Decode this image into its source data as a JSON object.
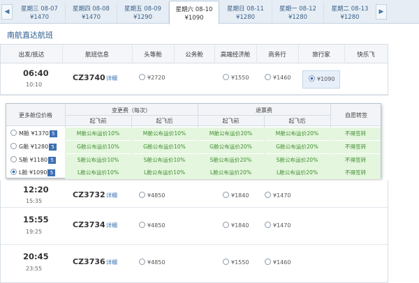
{
  "date_tabs": [
    {
      "date": "星期三  08-07",
      "price": "¥1470"
    },
    {
      "date": "星期四  08-08",
      "price": "¥1470"
    },
    {
      "date": "星期五  08-09",
      "price": "¥1290"
    },
    {
      "date": "星期六  08-10",
      "price": "¥1090"
    },
    {
      "date": "星期日  08-11",
      "price": "¥1280"
    },
    {
      "date": "星期一  08-12",
      "price": "¥1280"
    },
    {
      "date": "星期二  08-13",
      "price": "¥1280"
    }
  ],
  "active_tab_index": 3,
  "heading": "南航直达航班",
  "columns": [
    "出发/抵达",
    "航班信息",
    "头等舱",
    "公务舱",
    "高端经济舱",
    "商务行",
    "旅行家",
    "快乐飞"
  ],
  "detail_label": "详细",
  "flights": [
    {
      "dep": "06:40",
      "arr": "10:10",
      "no": "CZ3740",
      "first": "¥2720",
      "premium": "¥1550",
      "biz": "¥1460",
      "traveler": "¥1090"
    },
    {
      "dep": "12:20",
      "arr": "15:35",
      "no": "CZ3732",
      "first": "¥4850",
      "premium": "¥1840",
      "biz": "¥1470",
      "traveler": ""
    },
    {
      "dep": "15:55",
      "arr": "19:25",
      "no": "CZ3734",
      "first": "¥4850",
      "premium": "¥1840",
      "biz": "¥1470",
      "traveler": ""
    },
    {
      "dep": "20:45",
      "arr": "23:55",
      "no": "CZ3736",
      "first": "¥4850",
      "premium": "¥1550",
      "biz": "¥1460",
      "traveler": ""
    }
  ],
  "popup": {
    "more_label": "更多舱位价格",
    "change_fee": "变更费（每次）",
    "refund_fee": "退票费",
    "endorse": "自愿转签",
    "before": "起飞前",
    "after": "起飞后",
    "badge": "5",
    "classes": [
      {
        "label": "M舱 ¥1370",
        "change_before": "M舱公布运价10%",
        "change_after": "M舱公布运价10%",
        "refund_before": "M舱公布运价20%",
        "refund_after": "M舱公布运价20%",
        "endorse": "不得签转",
        "selected": false
      },
      {
        "label": "G舱 ¥1280",
        "change_before": "G舱公布运价10%",
        "change_after": "G舱公布运价10%",
        "refund_before": "G舱公布运价20%",
        "refund_after": "G舱公布运价20%",
        "endorse": "不得签转",
        "selected": false
      },
      {
        "label": "S舱 ¥1180",
        "change_before": "S舱公布运价10%",
        "change_after": "S舱公布运价10%",
        "refund_before": "S舱公布运价20%",
        "refund_after": "S舱公布运价20%",
        "endorse": "不得签转",
        "selected": false
      },
      {
        "label": "L舱 ¥1090",
        "change_before": "L舱公布运价10%",
        "change_after": "L舱公布运价10%",
        "refund_before": "L舱公布运价20%",
        "refund_after": "L舱公布运价20%",
        "endorse": "不得签转",
        "selected": true
      }
    ]
  }
}
